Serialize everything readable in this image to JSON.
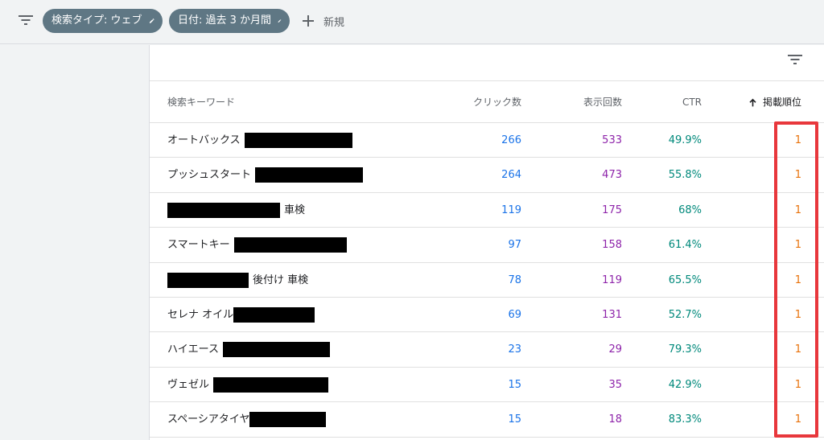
{
  "toolbar": {
    "chips": [
      {
        "label": "検索タイプ: ウェブ"
      },
      {
        "label": "日付: 過去 3 か月間"
      }
    ],
    "new_label": "新規"
  },
  "table": {
    "headers": {
      "query": "検索キーワード",
      "clicks": "クリック数",
      "impressions": "表示回数",
      "ctr": "CTR",
      "position": "掲載順位"
    },
    "rows": [
      {
        "prefix": "オートバックス",
        "suffix": "",
        "clicks": "266",
        "impressions": "533",
        "ctr": "49.9%",
        "position": "1"
      },
      {
        "prefix": "プッシュスタート",
        "suffix": "",
        "clicks": "264",
        "impressions": "473",
        "ctr": "55.8%",
        "position": "1"
      },
      {
        "prefix": "",
        "suffix": "車検",
        "clicks": "119",
        "impressions": "175",
        "ctr": "68%",
        "position": "1"
      },
      {
        "prefix": "スマートキー",
        "suffix": "",
        "clicks": "97",
        "impressions": "158",
        "ctr": "61.4%",
        "position": "1"
      },
      {
        "prefix": "",
        "suffix": "後付け 車検",
        "clicks": "78",
        "impressions": "119",
        "ctr": "65.5%",
        "position": "1"
      },
      {
        "prefix": "セレナ オイル",
        "suffix": "",
        "clicks": "69",
        "impressions": "131",
        "ctr": "52.7%",
        "position": "1"
      },
      {
        "prefix": "ハイエース",
        "suffix": "",
        "clicks": "23",
        "impressions": "29",
        "ctr": "79.3%",
        "position": "1"
      },
      {
        "prefix": "ヴェゼル",
        "suffix": "",
        "clicks": "15",
        "impressions": "35",
        "ctr": "42.9%",
        "position": "1"
      },
      {
        "prefix": "スペーシアタイヤ",
        "suffix": "",
        "clicks": "15",
        "impressions": "18",
        "ctr": "83.3%",
        "position": "1"
      }
    ]
  },
  "icons": {
    "filter": "filter-icon",
    "pencil": "pencil-icon",
    "plus": "plus-icon",
    "sort_arrow": "arrow-up-icon"
  },
  "colors": {
    "clicks": "#1a73e8",
    "impressions": "#8e24aa",
    "ctr": "#00897b",
    "position": "#e8710a",
    "chip": "#5f7784",
    "highlight": "#e8373c",
    "redaction": "#000000"
  }
}
